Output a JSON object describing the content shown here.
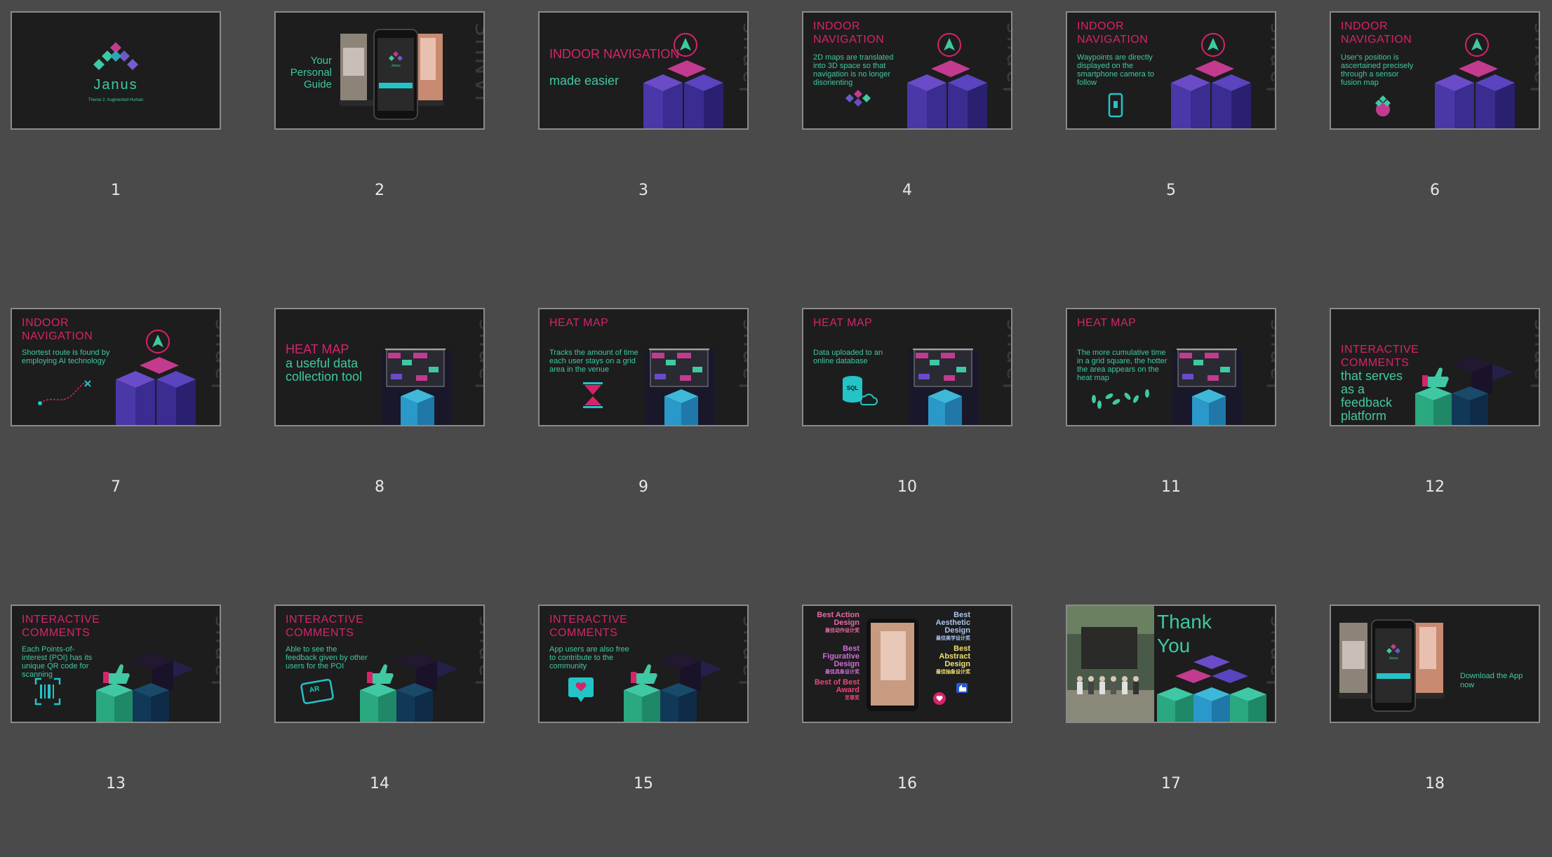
{
  "slides": [
    {
      "number": "1",
      "logo_text": "Janus",
      "subtitle": "Theme 2: Augmented Human"
    },
    {
      "number": "2",
      "title": "Your Personal Guide",
      "phone_logo": "Janus"
    },
    {
      "number": "3",
      "brand": "Janus",
      "heading": "INDOOR NAVIGATION",
      "subheading": "made easier"
    },
    {
      "number": "4",
      "brand": "Janus",
      "heading": "INDOOR NAVIGATION",
      "body": "2D maps are translated into 3D space so that navigation is no longer disorienting"
    },
    {
      "number": "5",
      "brand": "Janus",
      "heading": "INDOOR NAVIGATION",
      "body": "Waypoints are directly displayed on the smartphone camera to follow"
    },
    {
      "number": "6",
      "brand": "Janus",
      "heading": "INDOOR NAVIGATION",
      "body": "User's position is ascertained precisely through a sensor fusion map"
    },
    {
      "number": "7",
      "brand": "Janus",
      "heading": "INDOOR NAVIGATION",
      "body": "Shortest route is found by employing AI technology"
    },
    {
      "number": "8",
      "brand": "Janus",
      "heading": "HEAT MAP",
      "subheading": "a useful data collection tool"
    },
    {
      "number": "9",
      "brand": "Janus",
      "heading": "HEAT MAP",
      "body": "Tracks the amount of time each user stays on a grid area in the venue"
    },
    {
      "number": "10",
      "brand": "Janus",
      "heading": "HEAT MAP",
      "body": "Data uploaded to an online database",
      "icon_label": "SQL"
    },
    {
      "number": "11",
      "brand": "Janus",
      "heading": "HEAT MAP",
      "body": "The more cumulative time in a grid square, the hotter the area appears on the heat map"
    },
    {
      "number": "12",
      "brand": "Janus",
      "heading": "INTERACTIVE COMMENTS",
      "subheading": "that serves as a feedback platform"
    },
    {
      "number": "13",
      "brand": "Janus",
      "heading": "INTERACTIVE COMMENTS",
      "body": "Each Points-of-interest (POI) has its unique QR code for scanning"
    },
    {
      "number": "14",
      "brand": "Janus",
      "heading": "INTERACTIVE COMMENTS",
      "body": "Able to see the feedback given by other users for the POI",
      "icon_label": "AR"
    },
    {
      "number": "15",
      "brand": "Janus",
      "heading": "INTERACTIVE COMMENTS",
      "body": "App users are also free to contribute to the community"
    },
    {
      "number": "16",
      "awards": [
        {
          "en": "Best Action Design",
          "zh": "最佳动作设计奖",
          "color": "#e86aa8"
        },
        {
          "en": "Best Figurative Design",
          "zh": "最佳具象设计奖",
          "color": "#d06cd8"
        },
        {
          "en": "Best of Best Award",
          "zh": "至尊奖",
          "color": "#e8487a"
        },
        {
          "en": "Best Aesthetic Design",
          "zh": "最佳美学设计奖",
          "color": "#a9c4f0"
        },
        {
          "en": "Best Abstract Design",
          "zh": "最佳抽象设计奖",
          "color": "#f0e070"
        }
      ]
    },
    {
      "number": "17",
      "brand": "Janus",
      "title": "Thank You"
    },
    {
      "number": "18",
      "title": "Download the App now",
      "phone_logo": "Janus"
    }
  ],
  "colors": {
    "pink": "#d8236b",
    "green": "#3fc8a3",
    "cyan": "#23c4c8",
    "background": "#4a4a4a",
    "slide": "#1d1d1d"
  }
}
